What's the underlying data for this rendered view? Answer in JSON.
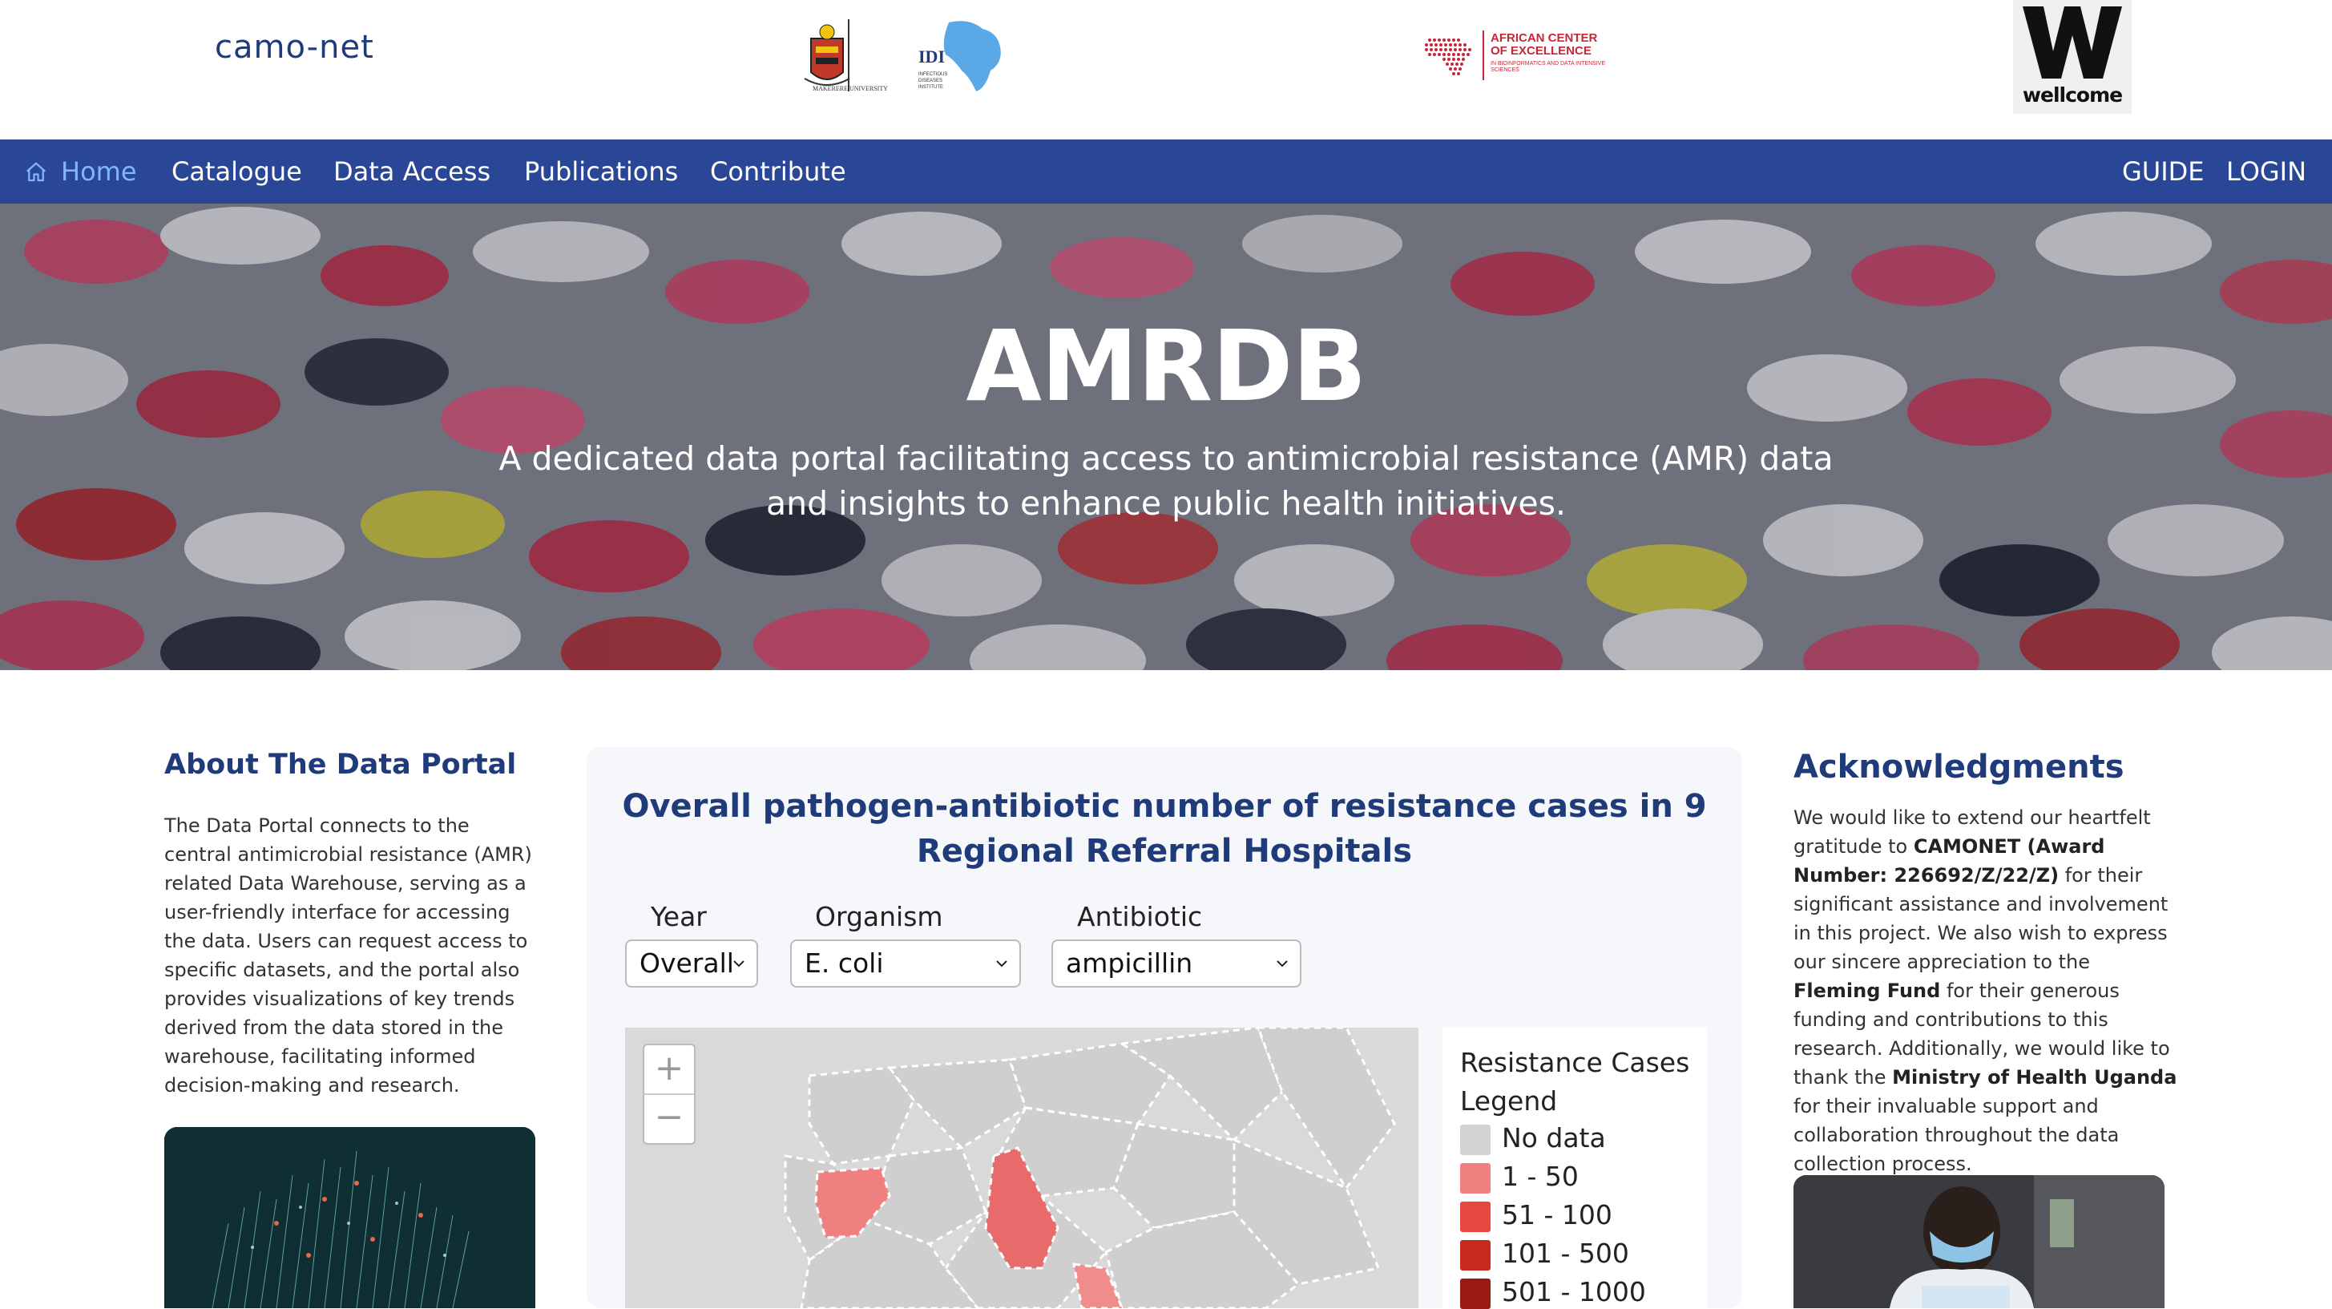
{
  "logos": {
    "camonet": "camo-net",
    "makerere_caption": "MAKERERE UNIVERSITY",
    "idi_caption": "INFECTIOUS DISEASES INSTITUTE",
    "ace_line1": "AFRICAN CENTER",
    "ace_line2": "OF EXCELLENCE",
    "ace_sub": "IN BIOINFORMATICS AND DATA INTENSIVE SCIENCES",
    "wellcome": "wellcome"
  },
  "nav": {
    "home": "Home",
    "catalogue": "Catalogue",
    "data_access": "Data Access",
    "publications": "Publications",
    "contribute": "Contribute",
    "guide": "GUIDE",
    "login": "LOGIN"
  },
  "hero": {
    "title": "AMRDB",
    "subtitle": "A dedicated data portal facilitating access to antimicrobial resistance (AMR) data and insights to enhance public health initiatives."
  },
  "about": {
    "title": "About The Data Portal",
    "text": "The Data Portal connects to the central antimicrobial resistance (AMR) related Data Warehouse, serving as a user-friendly interface for accessing the data. Users can request access to specific datasets, and the portal also provides visualizations of key trends derived from the data stored in the warehouse, facilitating informed decision-making and research."
  },
  "chart_card": {
    "title": "Overall pathogen-antibiotic number of resistance cases in 9 Regional Referral Hospitals",
    "filters": {
      "year_label": "Year",
      "year_value": "Overall",
      "organism_label": "Organism",
      "organism_value": "E. coli",
      "antibiotic_label": "Antibiotic",
      "antibiotic_value": "ampicillin"
    },
    "zoom_in": "+",
    "zoom_out": "−",
    "legend": {
      "title": "Resistance Cases Legend",
      "items": [
        {
          "label": "No data",
          "color": "#d3d3d3"
        },
        {
          "label": "1 - 50",
          "color": "#f08080"
        },
        {
          "label": "51 - 100",
          "color": "#e8473f"
        },
        {
          "label": "101 - 500",
          "color": "#c62a1c"
        },
        {
          "label": "501 - 1000",
          "color": "#9a1b12"
        }
      ]
    }
  },
  "acknowledgments": {
    "title": "Acknowledgments",
    "p1": "We would like to extend our heartfelt gratitude to ",
    "b1": "CAMONET (Award Number: 226692/Z/22/Z)",
    "p2": " for their significant assistance and involvement in this project. We also wish to express our sincere appreciation to the ",
    "b2": "Fleming Fund",
    "p3": " for their generous funding and contributions to this research. Additionally, we would like to thank the ",
    "b3": "Ministry of Health Uganda",
    "p4": " for their invaluable support and collaboration throughout the data collection process."
  },
  "colors": {
    "nav_bg": "#2a4696",
    "heading": "#1f3b7a",
    "home_active": "#7fb6ff"
  }
}
